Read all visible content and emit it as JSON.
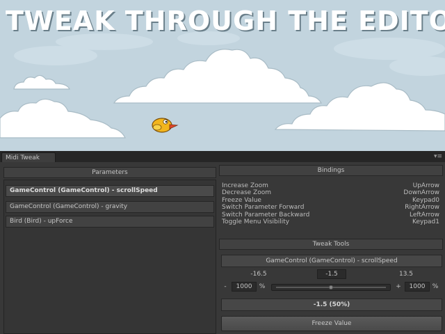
{
  "game": {
    "headline": "TWEAK THROUGH THE EDITOR",
    "sky_color": "#c2d4de"
  },
  "window": {
    "tab_label": "Midi Tweak",
    "tab_menu_icon": "panel-menu-icon"
  },
  "parameters": {
    "title": "Parameters",
    "items": [
      {
        "label": "GameControl (GameControl) - scrollSpeed",
        "selected": true
      },
      {
        "label": "GameControl (GameControl) - gravity",
        "selected": false
      },
      {
        "label": "Bird (Bird) - upForce",
        "selected": false
      }
    ]
  },
  "bindings": {
    "title": "Bindings",
    "rows": [
      {
        "action": "Increase Zoom",
        "key": "UpArrow"
      },
      {
        "action": "Decrease Zoom",
        "key": "DownArrow"
      },
      {
        "action": "Freeze Value",
        "key": "Keypad0"
      },
      {
        "action": "Switch Parameter Forward",
        "key": "RightArrow"
      },
      {
        "action": "Switch Parameter Backward",
        "key": "LeftArrow"
      },
      {
        "action": "Toggle Menu Visibility",
        "key": "Keypad1"
      }
    ]
  },
  "tweak_tools": {
    "title": "Tweak Tools",
    "selected_parameter": "GameControl (GameControl) - scrollSpeed",
    "range_min": "-16.5",
    "current_value": "-1.5",
    "range_max": "13.5",
    "left_zoom": {
      "minus_label": "-",
      "value": "1000",
      "unit": "%"
    },
    "right_zoom": {
      "plus_label": "+",
      "value": "1000",
      "unit": "%"
    },
    "slider_fraction": 0.5,
    "readout": "-1.5 (50%)",
    "freeze_button_label": "Freeze Value"
  }
}
